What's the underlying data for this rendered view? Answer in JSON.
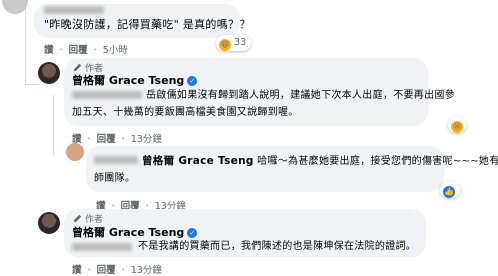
{
  "comment1": {
    "text": "\"昨晚沒防護，記得買藥吃\" 是真的嗎？？",
    "like": "讚",
    "reply": "回覆",
    "time": "5小時",
    "reaction_count": "33"
  },
  "comment2": {
    "author_badge": "作者",
    "author": "曾格爾 Grace Tseng",
    "line1": "岳啟儒如果沒有歸到踏人說明，建議她下次本人出庭，不要再出國參",
    "line2": "加五天、十幾萬的要飯團高檔美食園又說歸到喔。",
    "like": "讚",
    "reply": "回覆",
    "time": "13分鐘"
  },
  "comment3": {
    "author": "曾格爾 Grace Tseng",
    "line1": "哈囉～為甚麼她要出庭，接受您們的傷害呢~~~她有律",
    "line2": "師團隊。",
    "like": "讚",
    "reply": "回覆",
    "time": "13分鐘"
  },
  "comment4": {
    "author_badge": "作者",
    "author": "曾格爾 Grace Tseng",
    "line1": "不是我講的買藥而已，我們陳述的也是陳坤保在法院的證詞。",
    "like": "讚",
    "reply": "回覆",
    "time": "13分鐘"
  },
  "icons": {
    "verified": "verified-badge-icon",
    "author_pen": "pen-icon",
    "react_like": "like-icon",
    "react_haha": "haha-icon",
    "react_sad": "sad-icon"
  },
  "colors": {
    "accent": "#1877f2",
    "bubble": "#f0f2f5",
    "meta": "#65676b"
  }
}
